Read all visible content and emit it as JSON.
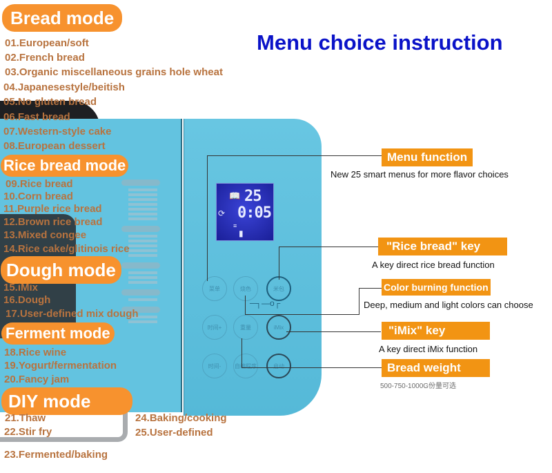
{
  "title": "Menu choice instruction",
  "modes": [
    {
      "label": "Bread mode",
      "items": [
        "01.European/soft",
        "02.French bread",
        "03.Organic miscellaneous grains hole wheat",
        "04.Japanesestyle/beitish",
        "05.No gluten bread",
        "06.Fast bread",
        "07.Western-style cake",
        "08.European dessert"
      ]
    },
    {
      "label": "Rice bread mode",
      "items": [
        "09.Rice bread",
        "10.Corn bread",
        "11.Purple rice bread",
        "12.Brown rice bread",
        "13.Mixed congee",
        "14.Rice cake/glitinois rice"
      ]
    },
    {
      "label": "Dough mode",
      "items": [
        "15.iMix",
        "16.Dough",
        "17.User-defined mix dough"
      ]
    },
    {
      "label": "Ferment mode",
      "items": [
        "18.Rice wine",
        "19.Yogurt/fermentation",
        "20.Fancy jam"
      ]
    },
    {
      "label": "DIY mode",
      "items": [
        "21.Thaw",
        "22.Stir fry",
        "23.Fermented/baking",
        "24.Baking/cooking",
        "25.User-defined"
      ]
    }
  ],
  "lcd": {
    "menu_number": "25",
    "time": "0:05"
  },
  "keys": {
    "menu": "菜单",
    "color": "烧色",
    "rice": "米包",
    "time_plus": "时间+",
    "weight": "重量",
    "imix": "iMix",
    "time_minus": "时间-",
    "custom": "自编程序",
    "start": "启动"
  },
  "callouts": [
    {
      "label": "Menu function",
      "desc": "New 25 smart menus for more flavor choices"
    },
    {
      "label": "\"Rice bread\" key",
      "desc": "A key direct rice bread function"
    },
    {
      "label": "Color burning function",
      "desc": "Deep, medium and light colors can choose"
    },
    {
      "label": "\"iMix\" key",
      "desc": "A key direct iMix function"
    },
    {
      "label": "Bread weight",
      "desc": "500-750-1000G份量可选"
    }
  ],
  "colors": {
    "accent_orange": "#f29413",
    "title_blue": "#0a12c8",
    "item_brown": "#b8733f",
    "device_blue": "#63c3e0"
  }
}
